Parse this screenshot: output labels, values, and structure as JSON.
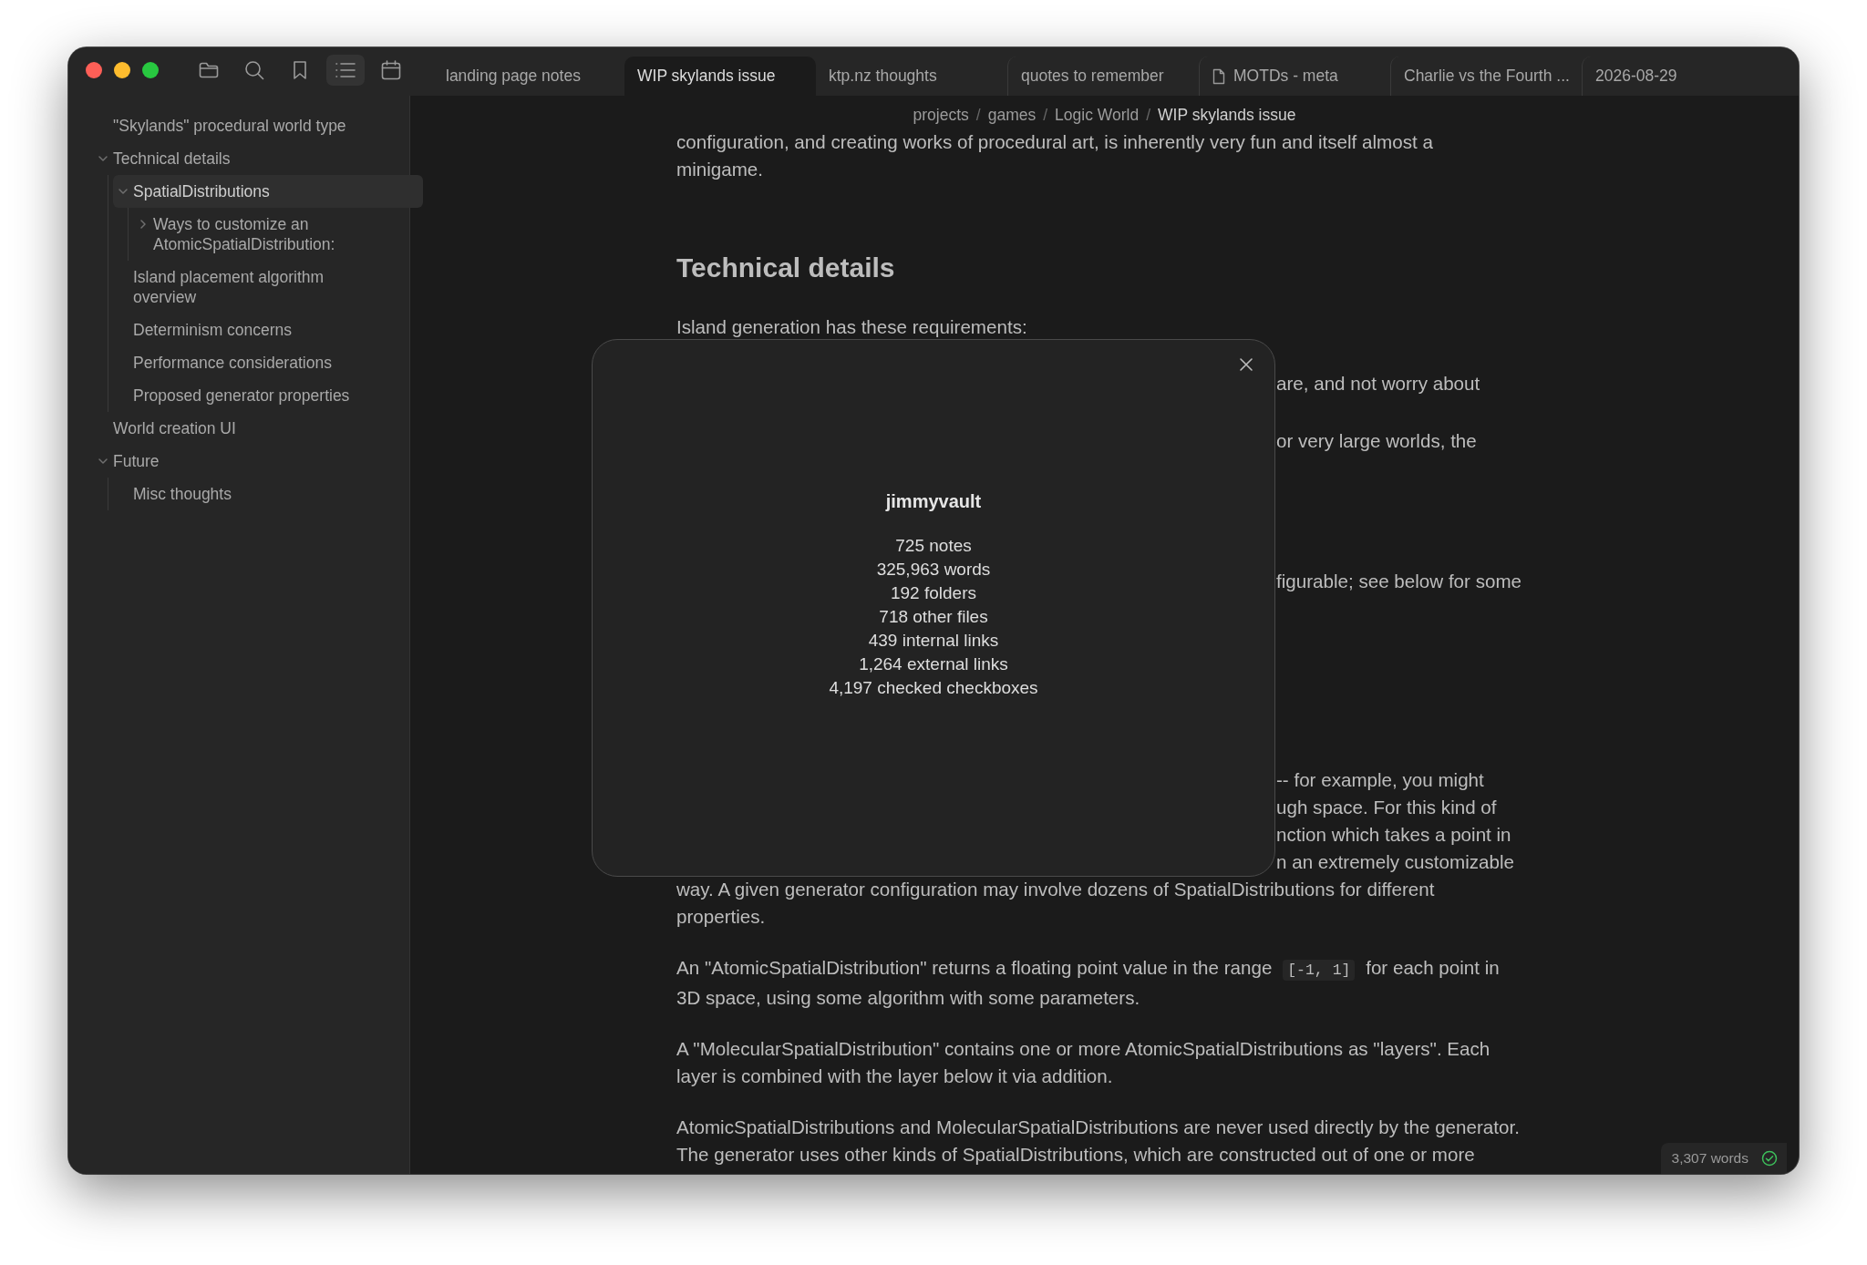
{
  "toolbar": [
    {
      "kind": "folder",
      "selected": false
    },
    {
      "kind": "search",
      "selected": false
    },
    {
      "kind": "bookmark",
      "selected": false
    },
    {
      "kind": "outline",
      "selected": true
    },
    {
      "kind": "calendar",
      "selected": false
    }
  ],
  "tabs": [
    {
      "label": "landing page notes",
      "kind": "note",
      "selected": false
    },
    {
      "label": "WIP skylands issue",
      "kind": "note",
      "selected": true
    },
    {
      "label": "ktp.nz thoughts",
      "kind": "note",
      "selected": false
    },
    {
      "label": "quotes to remember",
      "kind": "note",
      "selected": false
    },
    {
      "label": "MOTDs - meta",
      "kind": "file",
      "selected": false
    },
    {
      "label": "Charlie vs the Fourth ...",
      "kind": "note",
      "selected": false
    },
    {
      "label": "2026-08-29",
      "kind": "note",
      "selected": false
    }
  ],
  "sidebar": {
    "items": [
      {
        "label": "\"Skylands\" procedural world type",
        "selected": false
      },
      {
        "label": "Technical details",
        "selected": false,
        "expanded": true,
        "children": [
          {
            "label": "SpatialDistributions",
            "selected": true,
            "expanded": true,
            "children": [
              {
                "label": "Ways to customize an AtomicSpatialDistribution:",
                "selected": false,
                "expanded": false
              }
            ]
          },
          {
            "label": "Island placement algorithm overview",
            "selected": false
          },
          {
            "label": "Determinism concerns",
            "selected": false
          },
          {
            "label": "Performance considerations",
            "selected": false
          },
          {
            "label": "Proposed generator properties",
            "selected": false
          }
        ]
      },
      {
        "label": "World creation UI",
        "selected": false
      },
      {
        "label": "Future",
        "selected": false,
        "expanded": true,
        "children": [
          {
            "label": "Misc thoughts",
            "selected": false
          }
        ]
      }
    ]
  },
  "breadcrumb": {
    "separator": "/",
    "parts": [
      {
        "label": "projects",
        "current": false
      },
      {
        "label": "games",
        "current": false
      },
      {
        "label": "Logic World",
        "current": false
      },
      {
        "label": "WIP skylands issue",
        "current": true
      }
    ]
  },
  "document": {
    "blocks": [
      {
        "kind": "paragraph",
        "parts": [
          {
            "kind": "text",
            "text": "configuration, and creating works of procedural art, is inherently very fun and itself almost a minigame."
          }
        ]
      },
      {
        "kind": "heading",
        "text": "Technical details"
      },
      {
        "kind": "paragraph",
        "parts": [
          {
            "kind": "text",
            "text": "Island generation has these requirements:"
          }
        ]
      },
      {
        "kind": "partial",
        "lines": [
          "are, and not worry about"
        ]
      },
      {
        "kind": "partial",
        "lines": [
          "or very large worlds, the"
        ]
      },
      {
        "kind": "partial",
        "lines": [
          "figurable; see below for some"
        ]
      },
      {
        "kind": "partial",
        "lines": [
          "-- for example, you might",
          "ugh space. For this kind of",
          "nction which takes a point in",
          "n an extremely customizable"
        ],
        "tail": "way. A given generator configuration may involve dozens of SpatialDistributions for different properties."
      },
      {
        "kind": "paragraph",
        "parts": [
          {
            "kind": "text",
            "text": "An \"AtomicSpatialDistribution\" returns a floating point value in the range"
          },
          {
            "kind": "code",
            "text": "[-1, 1]"
          },
          {
            "kind": "text",
            "text": "for each point in 3D space, using some algorithm with some parameters."
          }
        ]
      },
      {
        "kind": "paragraph",
        "parts": [
          {
            "kind": "text",
            "text": "A \"MolecularSpatialDistribution\" contains one or more AtomicSpatialDistributions as \"layers\". Each layer is combined with the layer below it via addition."
          }
        ]
      },
      {
        "kind": "paragraph",
        "parts": [
          {
            "kind": "text",
            "text": "AtomicSpatialDistributions and MolecularSpatialDistributions are never used directly by the generator. The generator uses other kinds of SpatialDistributions, which are constructed out of one or more"
          }
        ]
      }
    ]
  },
  "modal": {
    "title": "jimmyvault",
    "stats": [
      "725 notes",
      "325,963 words",
      "192 folders",
      "718 other files",
      "439 internal links",
      "1,264 external links",
      "4,197 checked checkboxes"
    ]
  },
  "status_bar": {
    "word_count": "3,307 words",
    "synced": true
  }
}
